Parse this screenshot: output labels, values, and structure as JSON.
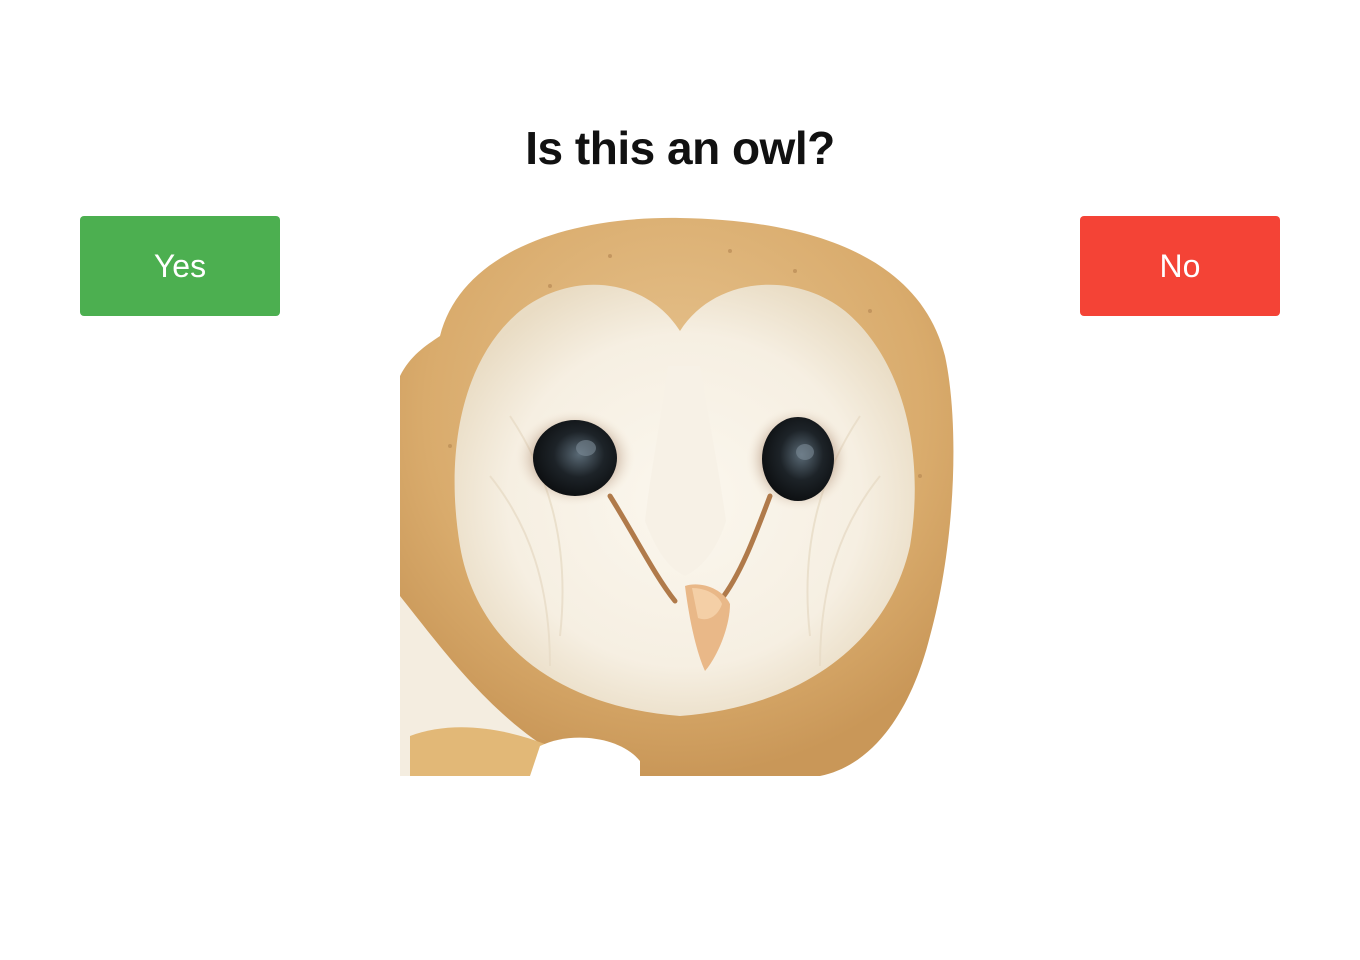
{
  "question": {
    "text": "Is this an owl?"
  },
  "buttons": {
    "yes_label": "Yes",
    "no_label": "No"
  },
  "colors": {
    "yes": "#4caf50",
    "no": "#f44336",
    "background": "#ffffff",
    "question_text": "#111111"
  },
  "photo": {
    "subject": "barn-owl-face"
  }
}
